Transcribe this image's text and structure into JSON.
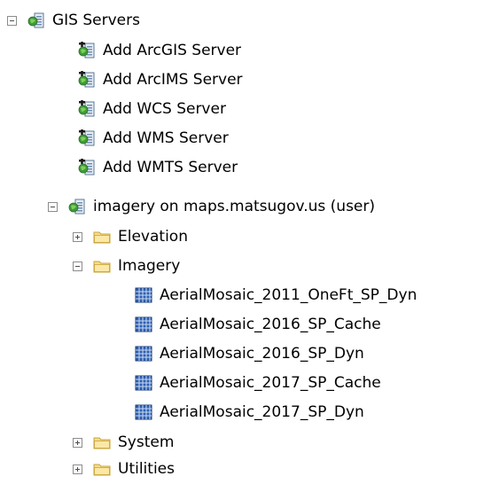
{
  "tree": {
    "root": {
      "label": "GIS Servers",
      "icon": "gis-servers-icon",
      "state": "expanded"
    },
    "add_items": [
      {
        "label": "Add ArcGIS Server",
        "icon": "add-server-icon"
      },
      {
        "label": "Add ArcIMS Server",
        "icon": "add-server-icon"
      },
      {
        "label": "Add WCS Server",
        "icon": "add-server-icon"
      },
      {
        "label": "Add WMS Server",
        "icon": "add-server-icon"
      },
      {
        "label": "Add WMTS Server",
        "icon": "add-server-icon"
      }
    ],
    "connection": {
      "label": "imagery on maps.matsugov.us (user)",
      "icon": "server-connection-icon",
      "state": "expanded"
    },
    "folders": [
      {
        "label": "Elevation",
        "state": "collapsed",
        "icon": "folder-icon"
      },
      {
        "label": "Imagery",
        "state": "expanded",
        "icon": "folder-icon",
        "highlighted": true,
        "highlight_color": "#ffff33"
      },
      {
        "label": "System",
        "state": "collapsed",
        "icon": "folder-icon"
      },
      {
        "label": "Utilities",
        "state": "collapsed",
        "icon": "folder-icon"
      }
    ],
    "imagery_services": [
      {
        "label": "AerialMosaic_2011_OneFt_SP_Dyn",
        "icon": "image-service-icon"
      },
      {
        "label": "AerialMosaic_2016_SP_Cache",
        "icon": "image-service-icon"
      },
      {
        "label": "AerialMosaic_2016_SP_Dyn",
        "icon": "image-service-icon"
      },
      {
        "label": "AerialMosaic_2017_SP_Cache",
        "icon": "image-service-icon"
      },
      {
        "label": "AerialMosaic_2017_SP_Dyn",
        "icon": "image-service-icon"
      }
    ]
  }
}
